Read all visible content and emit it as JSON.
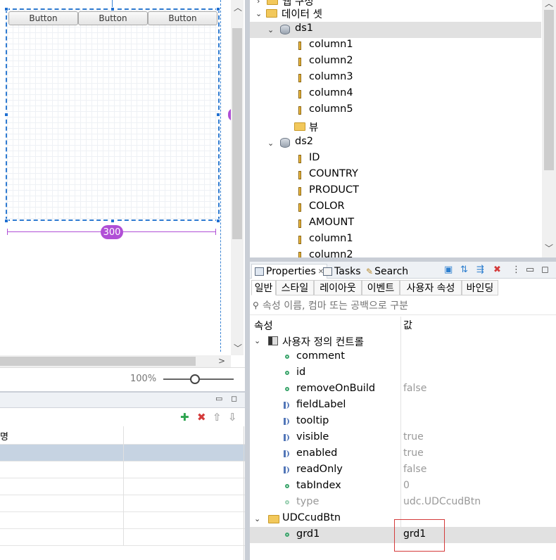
{
  "designer": {
    "buttons": [
      "Button",
      "Button",
      "Button"
    ],
    "width_badge": "300",
    "zoom": "100%"
  },
  "list_panel": {
    "header": "명"
  },
  "tree": {
    "partial_top_label": "웹 구성",
    "dataset_folder": "데이터 셋",
    "ds1": {
      "label": "ds1",
      "columns": [
        "column1",
        "column2",
        "column3",
        "column4",
        "column5"
      ]
    },
    "view_folder": "뷰",
    "ds2": {
      "label": "ds2",
      "columns": [
        "ID",
        "COUNTRY",
        "PRODUCT",
        "COLOR",
        "AMOUNT",
        "column1",
        "column2"
      ]
    }
  },
  "properties": {
    "view_tabs": [
      "Properties",
      "Tasks",
      "Search"
    ],
    "category_tabs": [
      "일반",
      "스타일",
      "레이아웃",
      "이벤트",
      "사용자 속성",
      "바인딩"
    ],
    "filter_placeholder": "속성 이름, 컴마 또는 공백으로 구분",
    "col_property": "속성",
    "col_value": "값",
    "group1": "사용자 정의 컨트롤",
    "rows": [
      {
        "name": "comment",
        "value": "",
        "icon": "dot-icon"
      },
      {
        "name": "id",
        "value": "",
        "icon": "dot-icon"
      },
      {
        "name": "removeOnBuild",
        "value": "false",
        "icon": "dot-icon"
      },
      {
        "name": "fieldLabel",
        "value": "",
        "icon": "speaker-icon"
      },
      {
        "name": "tooltip",
        "value": "",
        "icon": "speaker-icon"
      },
      {
        "name": "visible",
        "value": "true",
        "icon": "speaker-icon"
      },
      {
        "name": "enabled",
        "value": "true",
        "icon": "speaker-icon"
      },
      {
        "name": "readOnly",
        "value": "false",
        "icon": "speaker-icon"
      },
      {
        "name": "tabIndex",
        "value": "0",
        "icon": "dot-icon"
      },
      {
        "name": "type",
        "value": "udc.UDCcudBtn",
        "icon": "dot-icon"
      }
    ],
    "group2": "UDCcudBtn",
    "selected_row": {
      "name": "grd1",
      "value": "grd1"
    }
  },
  "colors": {
    "accent_purple": "#b04fd6",
    "selection_blue": "#2f7bd1",
    "highlight_red": "#d43b3b"
  }
}
